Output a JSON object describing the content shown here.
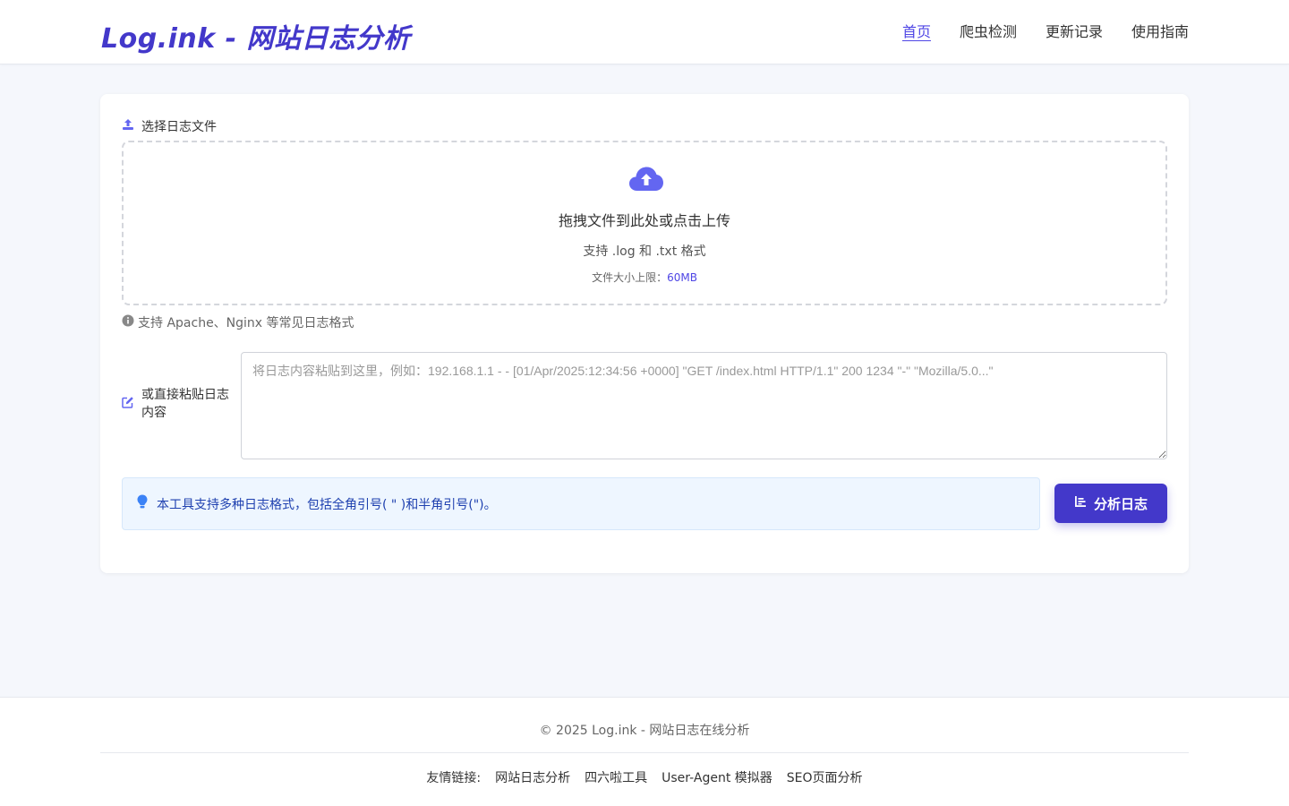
{
  "header": {
    "logo": "Log.ink - 网站日志分析",
    "nav": [
      {
        "label": "首页",
        "active": true
      },
      {
        "label": "爬虫检测",
        "active": false
      },
      {
        "label": "更新记录",
        "active": false
      },
      {
        "label": "使用指南",
        "active": false
      }
    ]
  },
  "upload": {
    "section_label": "选择日志文件",
    "title": "拖拽文件到此处或点击上传",
    "formats": "支持 .log 和 .txt 格式",
    "limit_label": "文件大小上限：",
    "limit_value": "60MB",
    "support_note": "支持 Apache、Nginx 等常见日志格式"
  },
  "paste": {
    "label": "或直接粘贴日志内容",
    "placeholder": "将日志内容粘贴到这里，例如：192.168.1.1 - - [01/Apr/2025:12:34:56 +0000] \"GET /index.html HTTP/1.1\" 200 1234 \"-\" \"Mozilla/5.0...\"",
    "value": ""
  },
  "tip": {
    "text": "本工具支持多种日志格式，包括全角引号( \" )和半角引号(\")。"
  },
  "actions": {
    "analyze_label": "分析日志"
  },
  "footer": {
    "copyright": "© 2025 Log.ink - 网站日志在线分析",
    "links_label": "友情链接:",
    "links": [
      "网站日志分析",
      "四六啦工具",
      "User-Agent 模拟器",
      "SEO页面分析"
    ]
  },
  "colors": {
    "brand": "#4338ca",
    "accent": "#4f46e5",
    "icon": "#6366f1",
    "tip_bg": "#eef6ff",
    "tip_text": "#1e40af"
  },
  "icons": {
    "upload_label": "upload-icon",
    "dropzone": "cloud-upload-icon",
    "info": "info-circle-icon",
    "edit": "edit-icon",
    "tip": "lightbulb-icon",
    "analyze": "chart-bar-icon"
  }
}
